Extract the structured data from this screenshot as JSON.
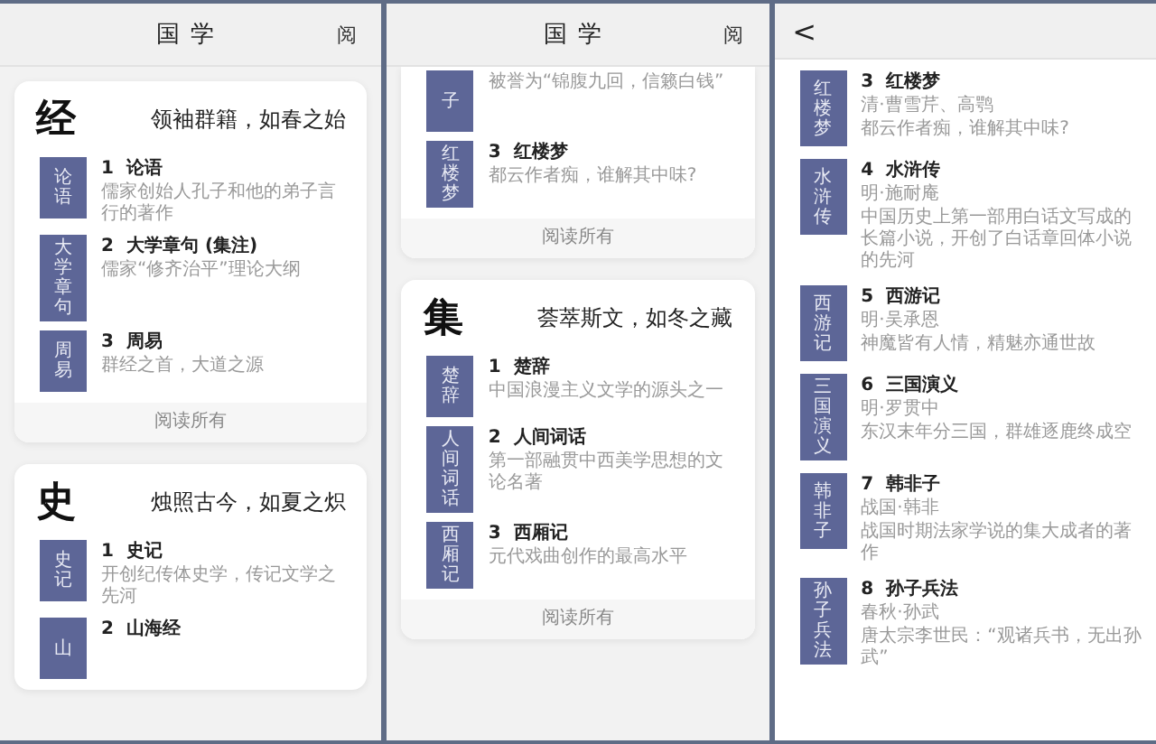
{
  "screens": [
    {
      "kind": "home",
      "header": {
        "title": "国学",
        "action": "阅"
      },
      "sections": [
        {
          "glyph": "经",
          "motto": "领袖群籍，如春之始",
          "footer": "阅读所有",
          "items": [
            {
              "number": "1",
              "title": "论语",
              "cover": "论语",
              "description": "儒家创始人孔子和他的弟子言行的著作"
            },
            {
              "number": "2",
              "title": "大学章句 (集注)",
              "cover": "大学章句",
              "description": "儒家“修齐治平”理论大纲"
            },
            {
              "number": "3",
              "title": "周易",
              "cover": "周易",
              "description": "群经之首，大道之源"
            }
          ]
        },
        {
          "glyph": "史",
          "motto": "烛照古今，如夏之炽",
          "items": [
            {
              "number": "1",
              "title": "史记",
              "cover": "史记",
              "description": "开创纪传体史学，传记文学之先河"
            },
            {
              "number": "2",
              "title": "山海经",
              "cover": "山"
            }
          ]
        }
      ]
    },
    {
      "kind": "home",
      "header": {
        "title": "国学",
        "action": "阅"
      },
      "sections": [
        {
          "footer": "阅读所有",
          "items": [
            {
              "cover": "子",
              "description": "被誉为“锦腹九回，信籁白钱”"
            },
            {
              "number": "3",
              "title": "红楼梦",
              "cover": "红楼梦",
              "description": "都云作者痴，谁解其中味?"
            }
          ]
        },
        {
          "glyph": "集",
          "motto": "荟萃斯文，如冬之藏",
          "footer": "阅读所有",
          "items": [
            {
              "number": "1",
              "title": "楚辞",
              "cover": "楚辞",
              "description": "中国浪漫主义文学的源头之一"
            },
            {
              "number": "2",
              "title": "人间词话",
              "cover": "人间词话",
              "description": "第一部融贯中西美学思想的文论名著"
            },
            {
              "number": "3",
              "title": "西厢记",
              "cover": "西厢记",
              "description": "元代戏曲创作的最高水平"
            }
          ]
        }
      ]
    },
    {
      "kind": "list",
      "back": "<",
      "items": [
        {
          "number": "3",
          "title": "红楼梦",
          "cover": "红楼梦",
          "author": "清·曹雪芹、高鹗",
          "description": "都云作者痴，谁解其中味?"
        },
        {
          "number": "4",
          "title": "水浒传",
          "cover": "水浒传",
          "author": "明·施耐庵",
          "description": "中国历史上第一部用白话文写成的长篇小说，开创了白话章回体小说的先河"
        },
        {
          "number": "5",
          "title": "西游记",
          "cover": "西游记",
          "author": "明·吴承恩",
          "description": "神魔皆有人情，精魅亦通世故"
        },
        {
          "number": "6",
          "title": "三国演义",
          "cover": "三国演义",
          "author": "明·罗贯中",
          "description": "东汉末年分三国，群雄逐鹿终成空"
        },
        {
          "number": "7",
          "title": "韩非子",
          "cover": "韩非子",
          "author": "战国·韩非",
          "description": "战国时期法家学说的集大成者的著作"
        },
        {
          "number": "8",
          "title": "孙子兵法",
          "cover": "孙子兵法",
          "author": "春秋·孙武",
          "description": "唐太宗李世民：“观诸兵书，无出孙武”"
        }
      ]
    }
  ]
}
